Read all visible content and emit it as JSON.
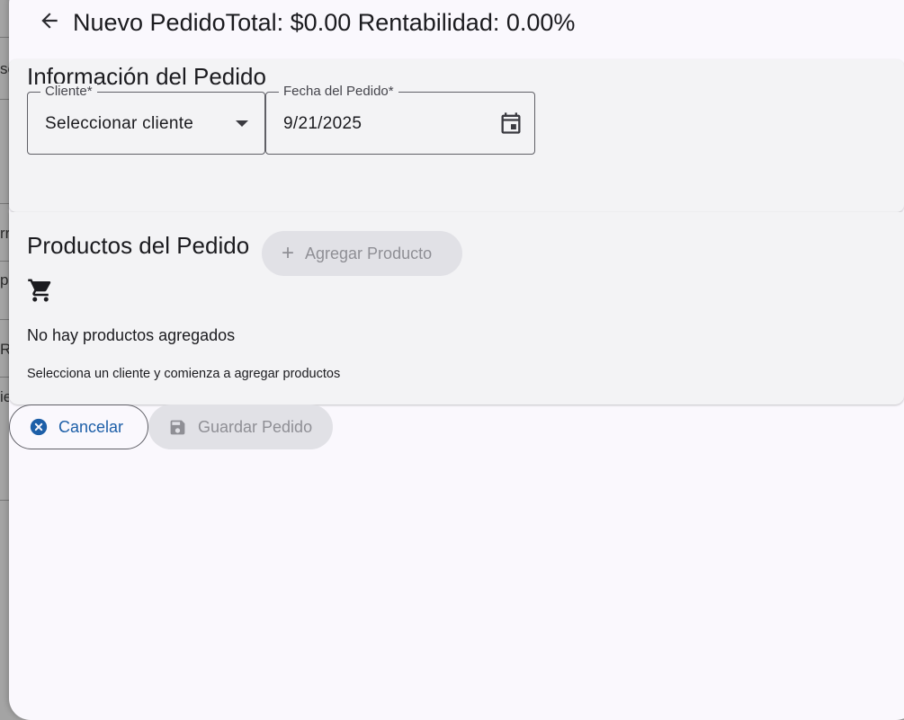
{
  "background_fragments": [
    {
      "text": "so"
    },
    {
      "text": "rr"
    },
    {
      "text": "pe"
    },
    {
      "text": "Rí"
    },
    {
      "text": "ie"
    }
  ],
  "header": {
    "title": "Nuevo PedidoTotal: $0.00 Rentabilidad: 0.00%",
    "back_icon": "arrow-back-icon"
  },
  "info_section": {
    "title": "Información del Pedido",
    "client_field": {
      "label": "Cliente*",
      "value": "Seleccionar cliente",
      "icon": "dropdown-arrow-icon"
    },
    "date_field": {
      "label": "Fecha del Pedido*",
      "value": "9/21/2025",
      "icon": "calendar-icon"
    }
  },
  "products_section": {
    "title": "Productos del Pedido",
    "add_button_label": "Agregar Producto",
    "empty_icon": "shopping-cart-icon",
    "empty_title": "No hay productos agregados",
    "empty_subtitle": "Selecciona un cliente y comienza a agregar productos"
  },
  "actions": {
    "cancel_label": "Cancelar",
    "save_label": "Guardar Pedido"
  },
  "colors": {
    "primary": "#1d5fa8",
    "disabled_bg": "#e1e1e6",
    "disabled_text": "#8f8f95",
    "card_bg": "#f3f3f5",
    "dialog_bg": "#faf8fd"
  }
}
